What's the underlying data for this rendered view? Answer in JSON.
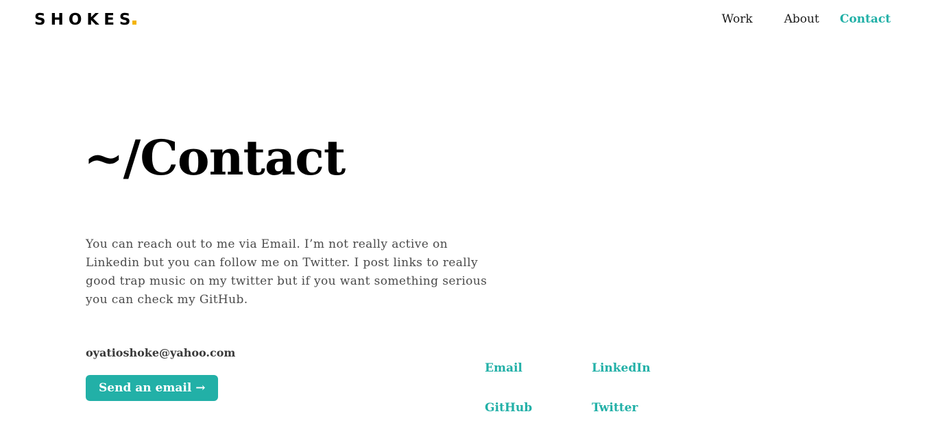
{
  "header": {
    "logo_text": "SHOKES",
    "nav": [
      {
        "label": "Work"
      },
      {
        "label": "About"
      },
      {
        "label": "Contact"
      }
    ]
  },
  "main": {
    "title": "~/Contact",
    "intro": "You can reach out to me via Email. I’m not really active on Linkedin but you can follow me on Twitter. I post links to really good trap music on my twitter but if you want something serious you can check my GitHub.",
    "email_address": "oyatioshoke@yahoo.com",
    "send_button_label": "Send an email →"
  },
  "social_links": [
    {
      "label": "Email"
    },
    {
      "label": "LinkedIn"
    },
    {
      "label": "GitHub"
    },
    {
      "label": "Twitter"
    }
  ],
  "colors": {
    "accent": "#22b0a7",
    "logo_dot": "#f4b400",
    "text": "#000000",
    "body_text": "#4a4a4a"
  }
}
